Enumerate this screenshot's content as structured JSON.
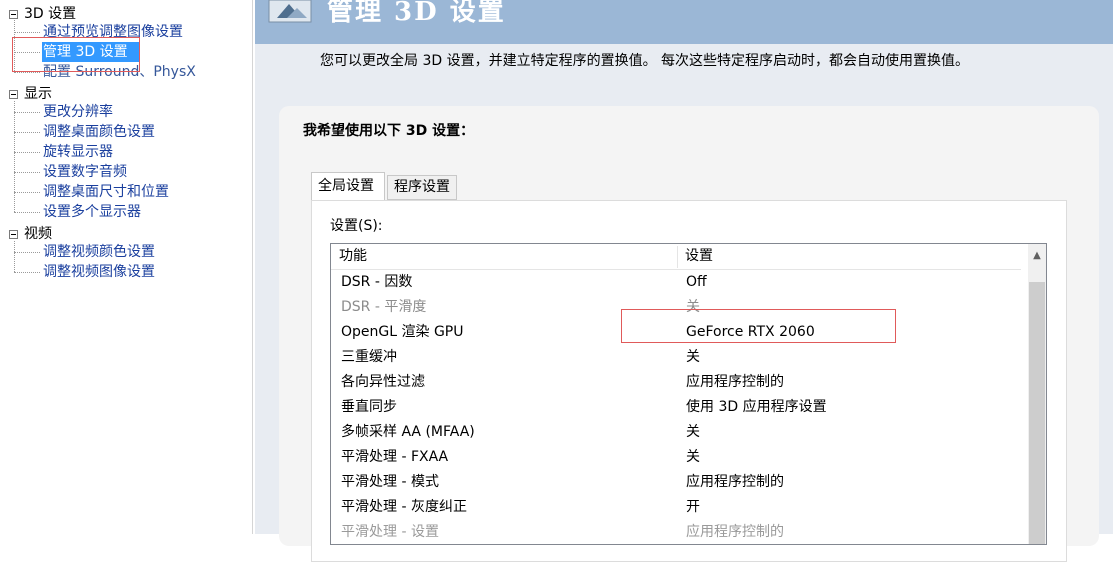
{
  "tree": {
    "categories": [
      {
        "label": "3D 设置",
        "items": [
          "通过预览调整图像设置",
          "管理 3D 设置",
          "配置 Surround、PhysX"
        ]
      },
      {
        "label": "显示",
        "items": [
          "更改分辨率",
          "调整桌面颜色设置",
          "旋转显示器",
          "设置数字音频",
          "调整桌面尺寸和位置",
          "设置多个显示器"
        ]
      },
      {
        "label": "视频",
        "items": [
          "调整视频颜色设置",
          "调整视频图像设置"
        ]
      }
    ]
  },
  "header": {
    "title": "管理 3D 设置",
    "icon": "nvidia-3d-icon"
  },
  "main": {
    "description": "您可以更改全局 3D 设置，并建立特定程序的置换值。 每次这些特定程序启动时，都会自动使用置换值。",
    "heading": "我希望使用以下 3D 设置：",
    "tabs": [
      {
        "label": "全局设置",
        "active": true
      },
      {
        "label": "程序设置",
        "active": false
      }
    ],
    "settings_label": "设置(S):",
    "columns": [
      "功能",
      "设置"
    ],
    "rows": [
      {
        "feature": "DSR - 因数",
        "value": "Off",
        "disabled": false
      },
      {
        "feature": "DSR - 平滑度",
        "value": "关",
        "disabled": true
      },
      {
        "feature": "OpenGL 渲染 GPU",
        "value": "GeForce RTX 2060",
        "disabled": false
      },
      {
        "feature": "三重缓冲",
        "value": "关",
        "disabled": false
      },
      {
        "feature": "各向异性过滤",
        "value": "应用程序控制的",
        "disabled": false
      },
      {
        "feature": "垂直同步",
        "value": "使用 3D 应用程序设置",
        "disabled": false
      },
      {
        "feature": "多帧采样 AA (MFAA)",
        "value": "关",
        "disabled": false
      },
      {
        "feature": "平滑处理 - FXAA",
        "value": "关",
        "disabled": false
      },
      {
        "feature": "平滑处理 - 模式",
        "value": "应用程序控制的",
        "disabled": false
      },
      {
        "feature": "平滑处理 - 灰度纠正",
        "value": "开",
        "disabled": false
      },
      {
        "feature": "平滑处理 - 设置",
        "value": "应用程序控制的",
        "disabled": false
      }
    ]
  },
  "colors": {
    "header": "#9bb7d6",
    "selection": "#3399ff",
    "highlight_box": "#e05a5a",
    "link": "#1a3f9e"
  }
}
